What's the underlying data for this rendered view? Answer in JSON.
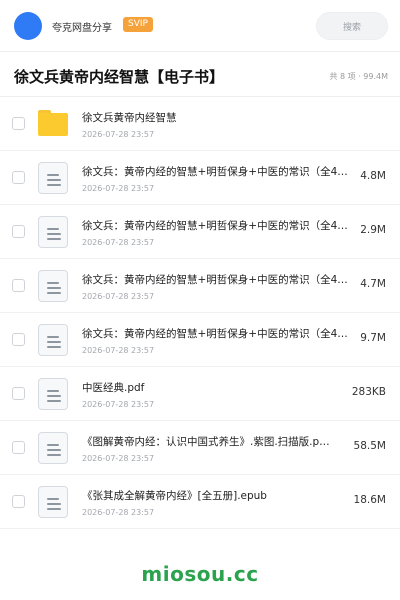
{
  "header": {
    "share_name": "夸克网盘分享",
    "badge": "SVIP",
    "search_label": "搜索"
  },
  "folder": {
    "title": "徐文兵黄帝内经智慧【电子书】",
    "summary": "共 8 项 · 99.4M"
  },
  "files": [
    {
      "name": "徐文兵黄帝内经智慧",
      "date": "2026-07-28 23:57",
      "size": "",
      "type": "folder"
    },
    {
      "name": "徐文兵：黄帝内经的智慧+明哲保身+中医的常识（全4…",
      "date": "2026-07-28 23:57",
      "size": "4.8M",
      "type": "doc"
    },
    {
      "name": "徐文兵：黄帝内经的智慧+明哲保身+中医的常识（全4…",
      "date": "2026-07-28 23:57",
      "size": "2.9M",
      "type": "doc"
    },
    {
      "name": "徐文兵：黄帝内经的智慧+明哲保身+中医的常识（全4…",
      "date": "2026-07-28 23:57",
      "size": "4.7M",
      "type": "doc"
    },
    {
      "name": "徐文兵：黄帝内经的智慧+明哲保身+中医的常识（全4…",
      "date": "2026-07-28 23:57",
      "size": "9.7M",
      "type": "doc"
    },
    {
      "name": "中医经典.pdf",
      "date": "2026-07-28 23:57",
      "size": "283KB",
      "type": "doc"
    },
    {
      "name": "《图解黄帝内经：认识中国式养生》.紫图.扫描版.p…",
      "date": "2026-07-28 23:57",
      "size": "58.5M",
      "type": "doc"
    },
    {
      "name": "《张其成全解黄帝内经》[全五册].epub",
      "date": "2026-07-28 23:57",
      "size": "18.6M",
      "type": "doc"
    }
  ],
  "watermark": "miosou.cc",
  "colors": {
    "avatar": "#2f7bf5",
    "badge": "#f6a23a",
    "folder": "#fbca2f",
    "watermark": "#2aa24e"
  }
}
